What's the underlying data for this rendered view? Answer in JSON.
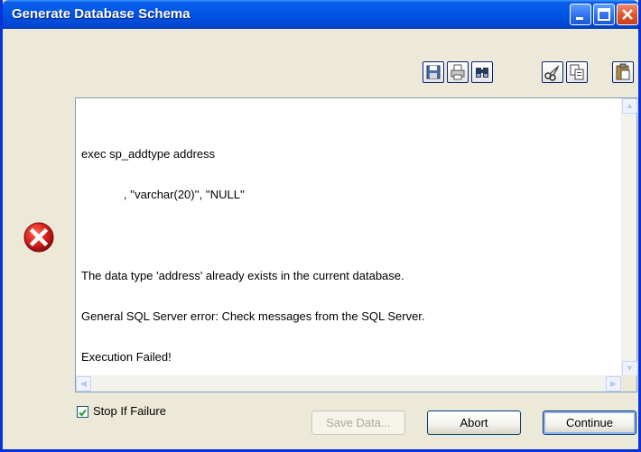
{
  "window": {
    "title": "Generate Database Schema"
  },
  "titlebar_buttons": [
    {
      "name": "minimize-button",
      "icon": "minimize-icon"
    },
    {
      "name": "maximize-button",
      "icon": "maximize-icon"
    },
    {
      "name": "close-button",
      "icon": "close-icon"
    }
  ],
  "toolbar": {
    "buttons": [
      {
        "name": "save-button",
        "icon": "floppy-disk-icon"
      },
      {
        "name": "print-button",
        "icon": "printer-icon"
      },
      {
        "name": "find-button",
        "icon": "binoculars-icon"
      },
      {
        "name": "cut-button",
        "icon": "scissors-icon"
      },
      {
        "name": "copy-button",
        "icon": "copy-icon"
      },
      {
        "name": "paste-button",
        "icon": "clipboard-icon"
      }
    ]
  },
  "output": {
    "lines": [
      "exec sp_addtype address",
      "             , ''varchar(20)'', ''NULL''",
      "",
      "The data type 'address' already exists in the current database.",
      "General SQL Server error: Check messages from the SQL Server.",
      "Execution Failed!"
    ]
  },
  "status_icon": "error-icon",
  "options": {
    "stop_if_failure_label": "Stop If Failure",
    "stop_if_failure_checked": true
  },
  "buttons": {
    "save_data": "Save Data...",
    "abort": "Abort",
    "continue": "Continue"
  },
  "colors": {
    "titlebar": "#0058e6",
    "error": "#d6201b",
    "window_bg": "#ece9d8"
  }
}
